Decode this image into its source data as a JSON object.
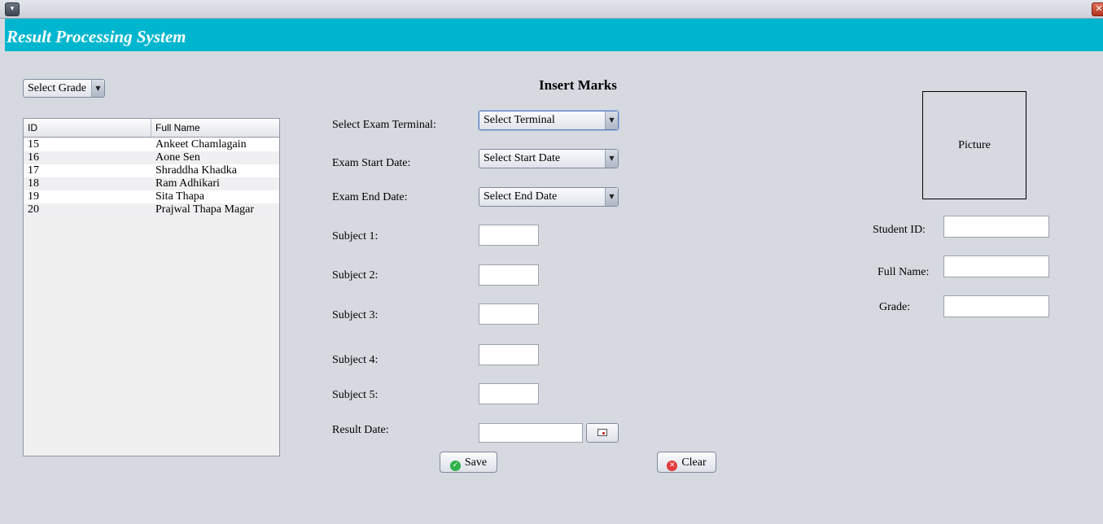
{
  "app": {
    "title": "Result Processing System",
    "menu_glyph": "▾",
    "close_glyph": "✕"
  },
  "left": {
    "grade_select": "Select Grade",
    "table": {
      "columns": [
        "ID",
        "Full Name"
      ],
      "rows": [
        {
          "id": "15",
          "name": "Ankeet  Chamlagain"
        },
        {
          "id": "16",
          "name": "Aone  Sen"
        },
        {
          "id": "17",
          "name": "Shraddha  Khadka"
        },
        {
          "id": "18",
          "name": "Ram  Adhikari"
        },
        {
          "id": "19",
          "name": "Sita  Thapa"
        },
        {
          "id": "20",
          "name": "Prajwal Thapa Magar"
        }
      ]
    }
  },
  "form": {
    "title": "Insert Marks",
    "exam_terminal_label": "Select Exam Terminal:",
    "exam_terminal_value": "Select Terminal",
    "start_date_label": "Exam Start Date:",
    "start_date_value": "Select Start Date",
    "end_date_label": "Exam End Date:",
    "end_date_value": "Select End Date",
    "subjects": [
      "Subject 1:",
      "Subject 2:",
      "Subject 3:",
      "Subject 4:",
      "Subject 5:"
    ],
    "result_date_label": "Result Date:",
    "save_label": "Save",
    "clear_label": "Clear",
    "dropdown_glyph": "▼"
  },
  "student": {
    "picture_label": "Picture",
    "id_label": "Student ID:",
    "name_label": "Full Name:",
    "grade_label": "Grade:"
  },
  "icons": {
    "save": "check-circle-icon",
    "clear": "x-circle-icon",
    "result_date": "calendar-icon"
  },
  "colors": {
    "banner": "#00b6cf",
    "background": "#d6d9e0"
  }
}
